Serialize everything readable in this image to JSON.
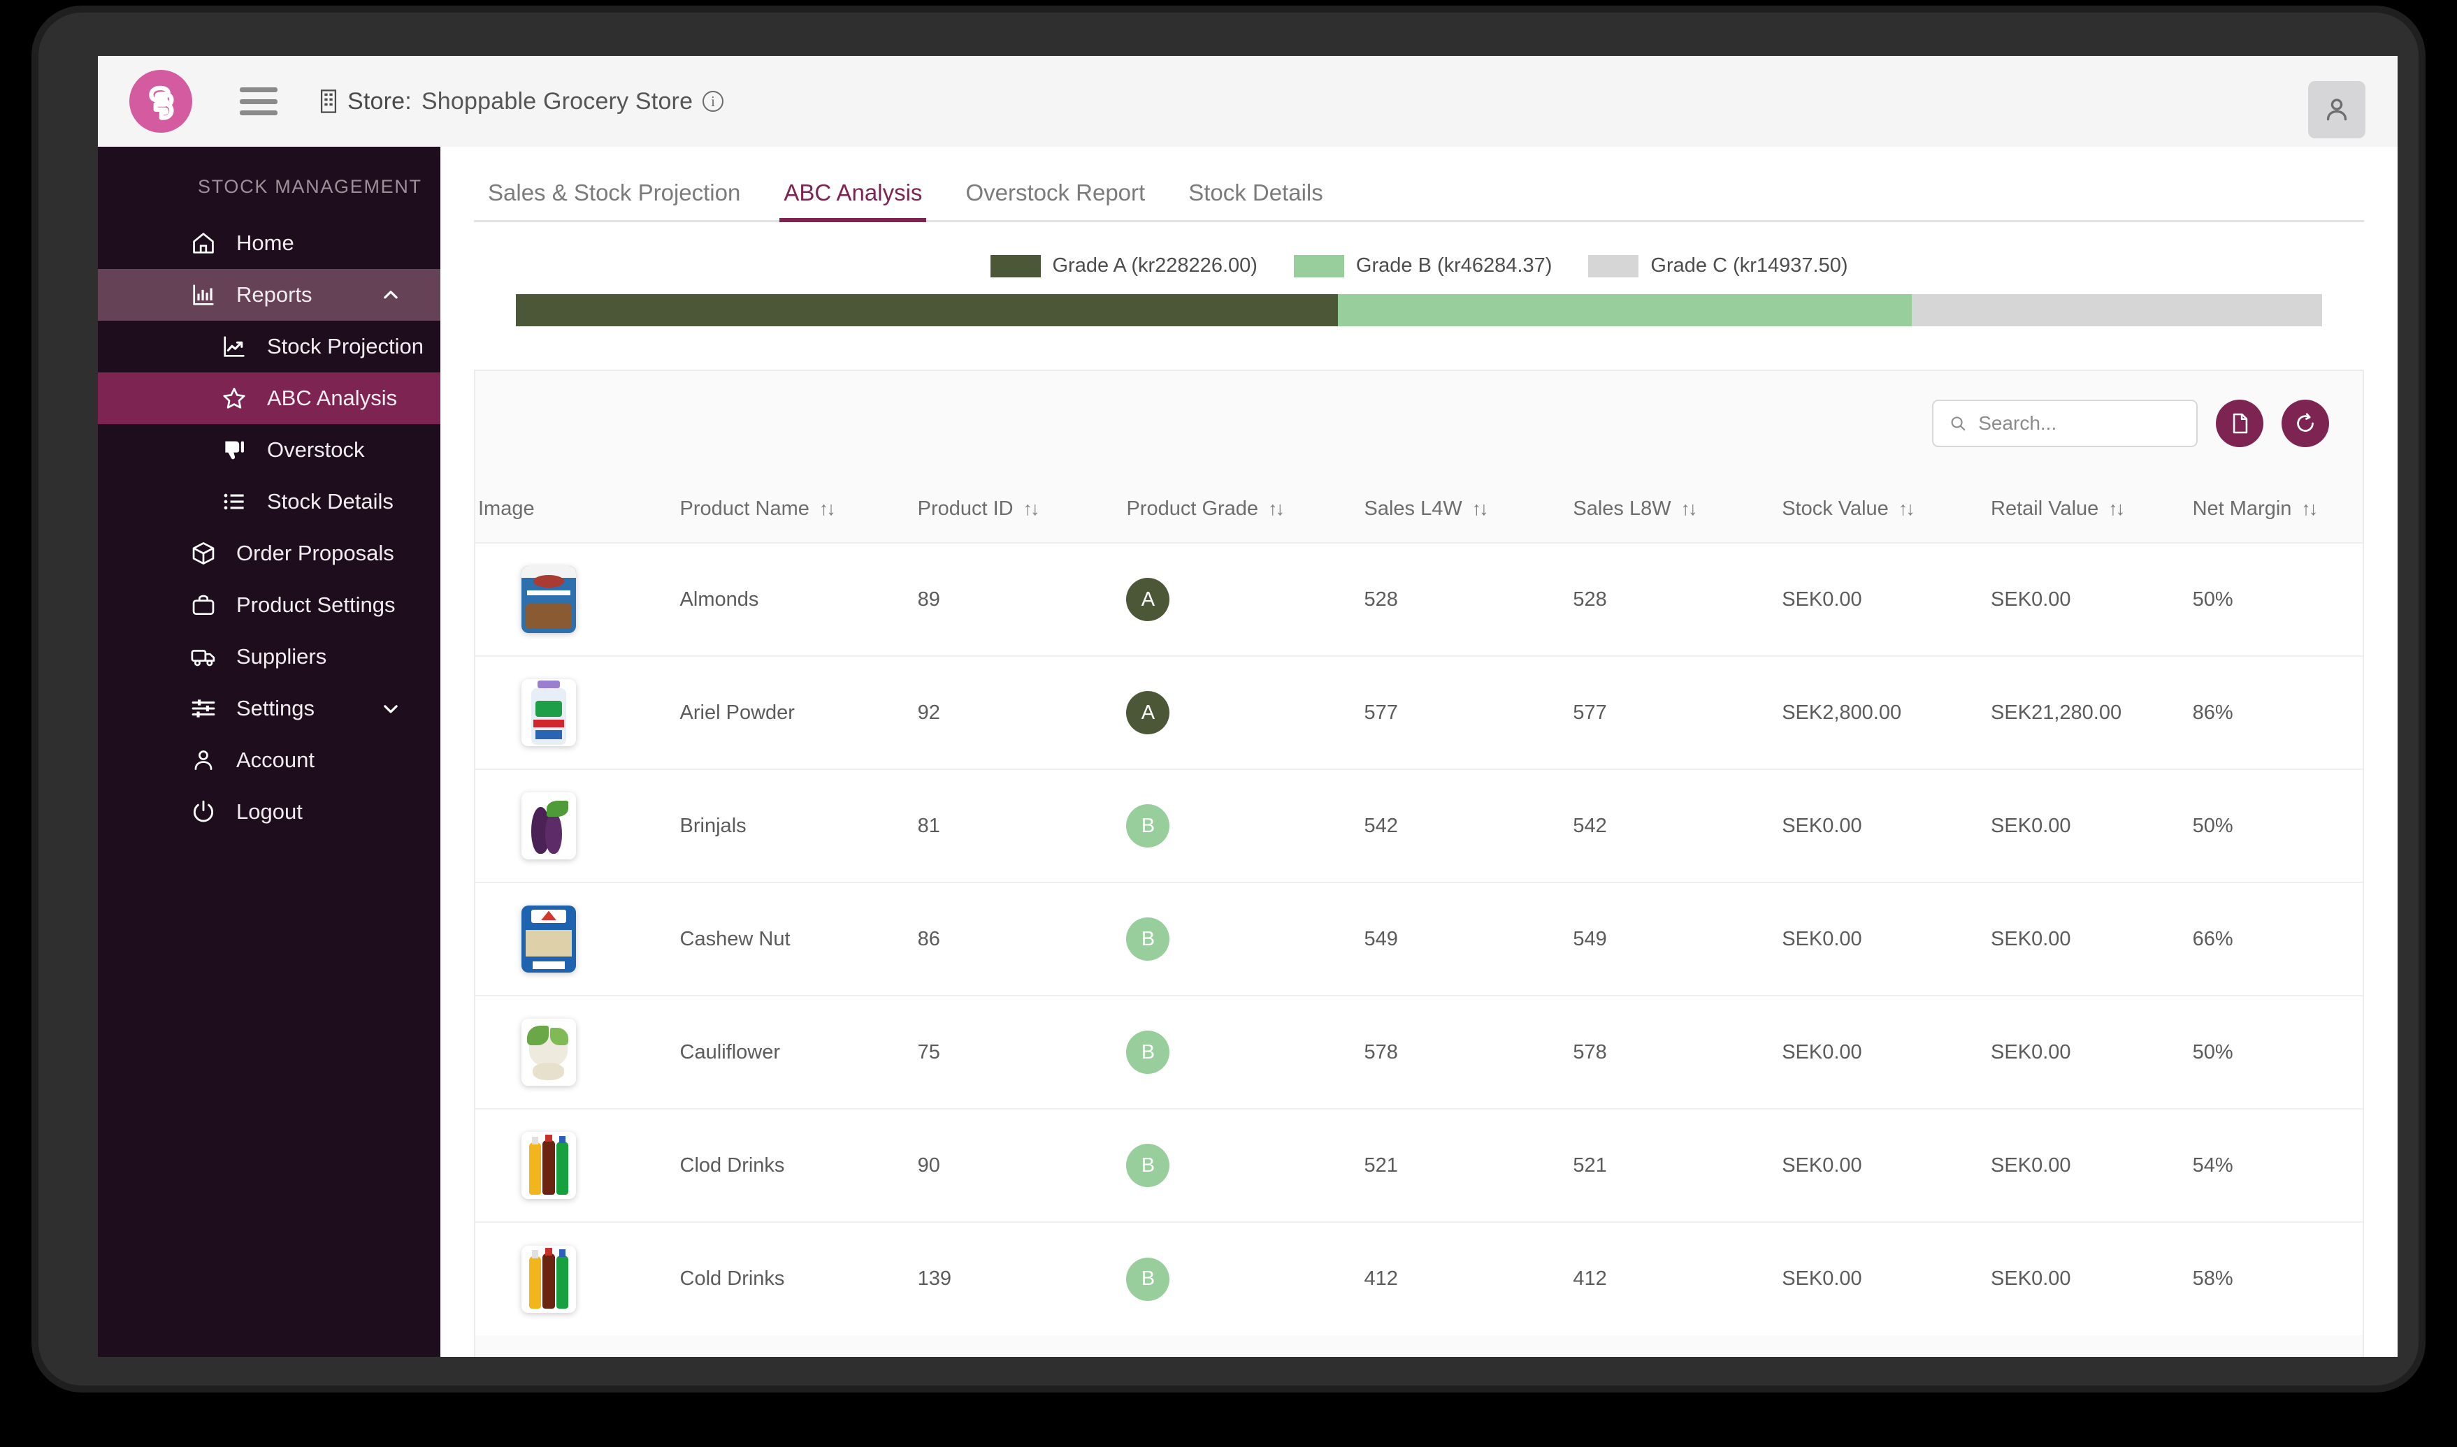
{
  "brand": {
    "logo_letter": "S",
    "logo_color": "#d45ba0"
  },
  "topbar": {
    "store_prefix": "Store:",
    "store_name": "Shoppable Grocery Store",
    "info_glyph": "i",
    "menu_icon": "hamburger-icon",
    "avatar_icon": "user-avatar-icon"
  },
  "sidebar": {
    "title": "STOCK MANAGEMENT",
    "items": [
      {
        "label": "Home",
        "icon": "home-icon",
        "state": "default"
      },
      {
        "label": "Reports",
        "icon": "bar-chart-icon",
        "state": "active-parent",
        "chevron": "chevron-up-icon"
      },
      {
        "label": "Stock Projection",
        "icon": "line-chart-icon",
        "state": "sub"
      },
      {
        "label": "ABC Analysis",
        "icon": "star-icon",
        "state": "sub-active"
      },
      {
        "label": "Overstock",
        "icon": "thumbs-down-icon",
        "state": "sub"
      },
      {
        "label": "Stock Details",
        "icon": "list-icon",
        "state": "sub"
      },
      {
        "label": "Order Proposals",
        "icon": "box-icon",
        "state": "default"
      },
      {
        "label": "Product Settings",
        "icon": "bag-icon",
        "state": "default"
      },
      {
        "label": "Suppliers",
        "icon": "truck-icon",
        "state": "default"
      },
      {
        "label": "Settings",
        "icon": "sliders-icon",
        "state": "default",
        "chevron": "chevron-down-icon"
      },
      {
        "label": "Account",
        "icon": "person-icon",
        "state": "default"
      },
      {
        "label": "Logout",
        "icon": "power-icon",
        "state": "default"
      }
    ]
  },
  "tabs": [
    {
      "label": "Sales & Stock Projection",
      "active": false
    },
    {
      "label": "ABC Analysis",
      "active": true
    },
    {
      "label": "Overstock Report",
      "active": false
    },
    {
      "label": "Stock Details",
      "active": false
    }
  ],
  "search": {
    "placeholder": "Search...",
    "value": "",
    "icon": "search-icon"
  },
  "toolbar_buttons": [
    {
      "name": "export-document-button",
      "icon": "document-icon"
    },
    {
      "name": "refresh-button",
      "icon": "refresh-icon"
    }
  ],
  "chart_data": {
    "type": "bar",
    "title": "",
    "categories": [
      "Grade A",
      "Grade B",
      "Grade C"
    ],
    "values": [
      228226.0,
      46284.37,
      14937.5
    ],
    "currency_prefix": "kr",
    "legend": [
      {
        "label": "Grade A (kr228226.00)",
        "color": "#4c5737"
      },
      {
        "label": "Grade B (kr46284.37)",
        "color": "#98cd9c"
      },
      {
        "label": "Grade C (kr14937.50)",
        "color": "#d6d6d6"
      }
    ],
    "segment_percent": [
      45.5,
      31.8,
      22.7
    ],
    "legend_position": "top-center",
    "grid": false,
    "xlabel": "",
    "ylabel": ""
  },
  "table": {
    "columns": [
      {
        "label": "Image",
        "sortable": false
      },
      {
        "label": "Product Name",
        "sortable": true
      },
      {
        "label": "Product ID",
        "sortable": true
      },
      {
        "label": "Product Grade",
        "sortable": true
      },
      {
        "label": "Sales L4W",
        "sortable": true
      },
      {
        "label": "Sales L8W",
        "sortable": true
      },
      {
        "label": "Stock Value",
        "sortable": true
      },
      {
        "label": "Retail Value",
        "sortable": true
      },
      {
        "label": "Net Margin",
        "sortable": true
      }
    ],
    "sort_glyph": "↑↓",
    "rows": [
      {
        "image": "almonds-pack",
        "name": "Almonds",
        "id": "89",
        "grade": "A",
        "sales_l4w": "528",
        "sales_l8w": "528",
        "stock_value": "SEK0.00",
        "retail_value": "SEK0.00",
        "net_margin": "50%"
      },
      {
        "image": "ariel-powder-bottle",
        "name": "Ariel Powder",
        "id": "92",
        "grade": "A",
        "sales_l4w": "577",
        "sales_l8w": "577",
        "stock_value": "SEK2,800.00",
        "retail_value": "SEK21,280.00",
        "net_margin": "86%"
      },
      {
        "image": "brinjals-eggplant",
        "name": "Brinjals",
        "id": "81",
        "grade": "B",
        "sales_l4w": "542",
        "sales_l8w": "542",
        "stock_value": "SEK0.00",
        "retail_value": "SEK0.00",
        "net_margin": "50%"
      },
      {
        "image": "cashew-nut-pack",
        "name": "Cashew Nut",
        "id": "86",
        "grade": "B",
        "sales_l4w": "549",
        "sales_l8w": "549",
        "stock_value": "SEK0.00",
        "retail_value": "SEK0.00",
        "net_margin": "66%"
      },
      {
        "image": "cauliflower",
        "name": "Cauliflower",
        "id": "75",
        "grade": "B",
        "sales_l4w": "578",
        "sales_l8w": "578",
        "stock_value": "SEK0.00",
        "retail_value": "SEK0.00",
        "net_margin": "50%"
      },
      {
        "image": "cold-drink-bottles",
        "name": "Clod Drinks",
        "id": "90",
        "grade": "B",
        "sales_l4w": "521",
        "sales_l8w": "521",
        "stock_value": "SEK0.00",
        "retail_value": "SEK0.00",
        "net_margin": "54%"
      },
      {
        "image": "cold-drink-bottles",
        "name": "Cold Drinks",
        "id": "139",
        "grade": "B",
        "sales_l4w": "412",
        "sales_l8w": "412",
        "stock_value": "SEK0.00",
        "retail_value": "SEK0.00",
        "net_margin": "58%"
      }
    ]
  },
  "colors": {
    "accent": "#7e2452",
    "sidebar_bg": "#1e0e1d",
    "sidebar_active_parent": "#664257",
    "sidebar_active_leaf": "#7e2452",
    "grade_a": "#4c5737",
    "grade_b": "#98cd9c",
    "grade_c": "#d6d6d6",
    "brand_pink": "#d45ba0"
  }
}
